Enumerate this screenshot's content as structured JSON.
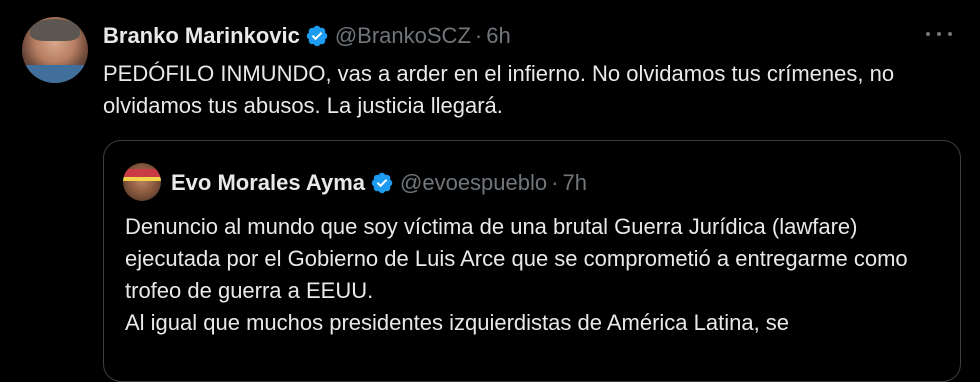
{
  "tweet": {
    "display_name": "Branko Marinkovic",
    "handle": "@BrankoSCZ",
    "separator": "·",
    "time": "6h",
    "text": "PEDÓFILO INMUNDO, vas a arder en el infierno. No olvidamos tus crímenes, no olvidamos tus abusos. La justicia llegará.",
    "more_icon": "more-horizontal-icon"
  },
  "quoted_tweet": {
    "display_name": "Evo Morales Ayma",
    "handle": "@evoespueblo",
    "separator": "·",
    "time": "7h",
    "paragraphs": [
      "Denuncio al mundo que soy víctima de una brutal Guerra Jurídica (lawfare) ejecutada por el Gobierno de Luis Arce que se comprometió a entregarme como trofeo de guerra a EEUU.",
      "Al igual que muchos presidentes izquierdistas de América Latina, se"
    ]
  },
  "colors": {
    "background": "#000000",
    "text": "#e7e9ea",
    "muted": "#71767b",
    "verified": "#1d9bf0",
    "border": "#3a3f44"
  }
}
